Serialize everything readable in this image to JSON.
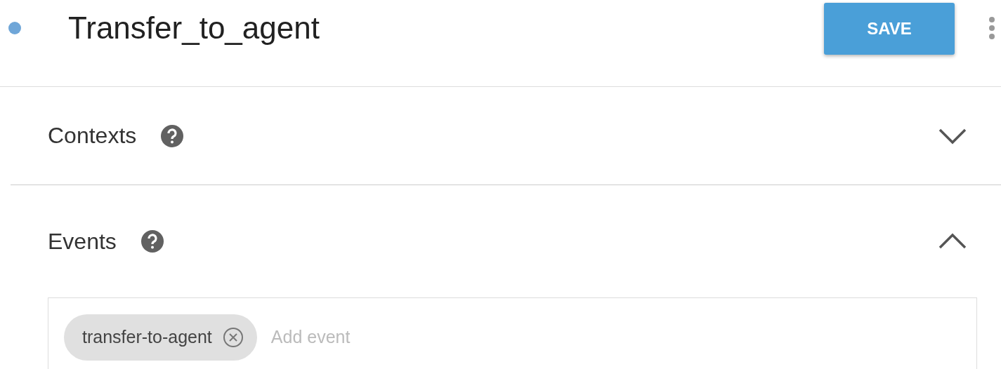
{
  "header": {
    "title": "Transfer_to_agent",
    "save_label": "SAVE"
  },
  "sections": [
    {
      "label": "Contexts",
      "expanded": false
    },
    {
      "label": "Events",
      "expanded": true,
      "chips": [
        "transfer-to-agent"
      ],
      "placeholder": "Add event"
    }
  ]
}
